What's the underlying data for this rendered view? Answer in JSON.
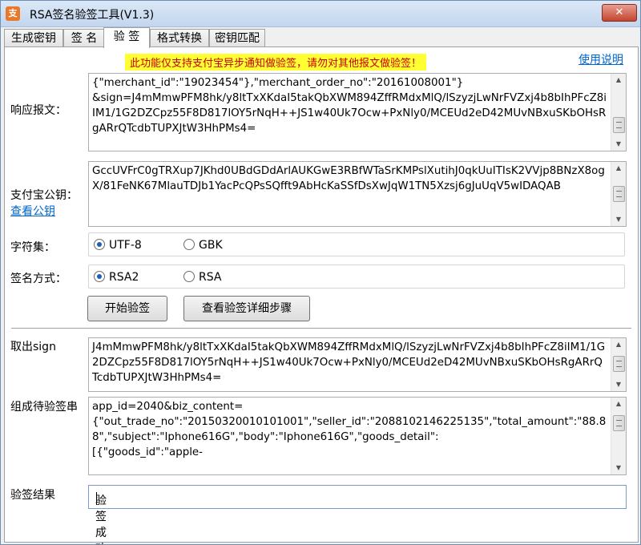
{
  "window": {
    "title": "RSA签名验签工具(V1.3)",
    "icon_glyph": "支",
    "close_label": "✕"
  },
  "tabs": [
    "生成密钥",
    "签 名",
    "验 签",
    "格式转换",
    "密钥匹配"
  ],
  "active_tab": "验 签",
  "notice": "此功能仅支持支付宝异步通知做验签，请勿对其他报文做验签！",
  "help_link": "使用说明",
  "response": {
    "label": "响应报文：",
    "value": "{\"merchant_id\":\"19023454\"},\"merchant_order_no\":\"20161008001\"}\n&sign=J4mMmwPFM8hk/y8ltTxXKdaI5takQbXWM894ZffRMdxMlQ/lSzyzjLwNrFVZxj4b8bIhPFcZ8iIM1/1G2DZCpz55F8D817lOY5rNqH++JS1w40Uk7Ocw+PxNly0/MCEUd2eD42MUvNBxuSKbOHsRgARrQTcdbTUPXJtW3HhPMs4="
  },
  "alipay_pubkey": {
    "label": "支付宝公钥：",
    "link": "查看公钥",
    "value": "GccUVFrC0gTRXup7JKhd0UBdGDdArlAUKGwE3RBfWTaSrKMPslXutihJ0qkUuITIsK2VVjp8BNzX8ogX/81FeNK67MlauTDJb1YacPcQPsSQfft9AbHcKaSSfDsXwJqW1TN5Xzsj6gJuUqV5wIDAQAB"
  },
  "charset": {
    "label": "字符集：",
    "options": [
      "UTF-8",
      "GBK"
    ],
    "selected": "UTF-8"
  },
  "sign_method": {
    "label": "签名方式：",
    "options": [
      "RSA2",
      "RSA"
    ],
    "selected": "RSA2"
  },
  "buttons": {
    "start": "开始验签",
    "detail": "查看验签详细步骤"
  },
  "extracted_sign": {
    "label": "取出sign",
    "value": "J4mMmwPFM8hk/y8ltTxXKdaI5takQbXWM894ZffRMdxMlQ/lSzyzjLwNrFVZxj4b8bIhPFcZ8iIM1/1G2DZCpz55F8D817lOY5rNqH++JS1w40Uk7Ocw+PxNly0/MCEUd2eD42MUvNBxuSKbOHsRgARrQTcdbTUPXJtW3HhPMs4="
  },
  "pending_string": {
    "label": "组成待验签串",
    "value": "app_id=2040&biz_content=\n{\"out_trade_no\":\"20150320010101001\",\"seller_id\":\"2088102146225135\",\"total_amount\":\"88.88\",\"subject\":\"Iphone616G\",\"body\":\"Iphone616G\",\"goods_detail\":\n[{\"goods_id\":\"apple-"
  },
  "result": {
    "label": "验签结果",
    "value": "验签成功"
  },
  "icons": {
    "scroll_up": "▲",
    "scroll_down": "▼"
  }
}
